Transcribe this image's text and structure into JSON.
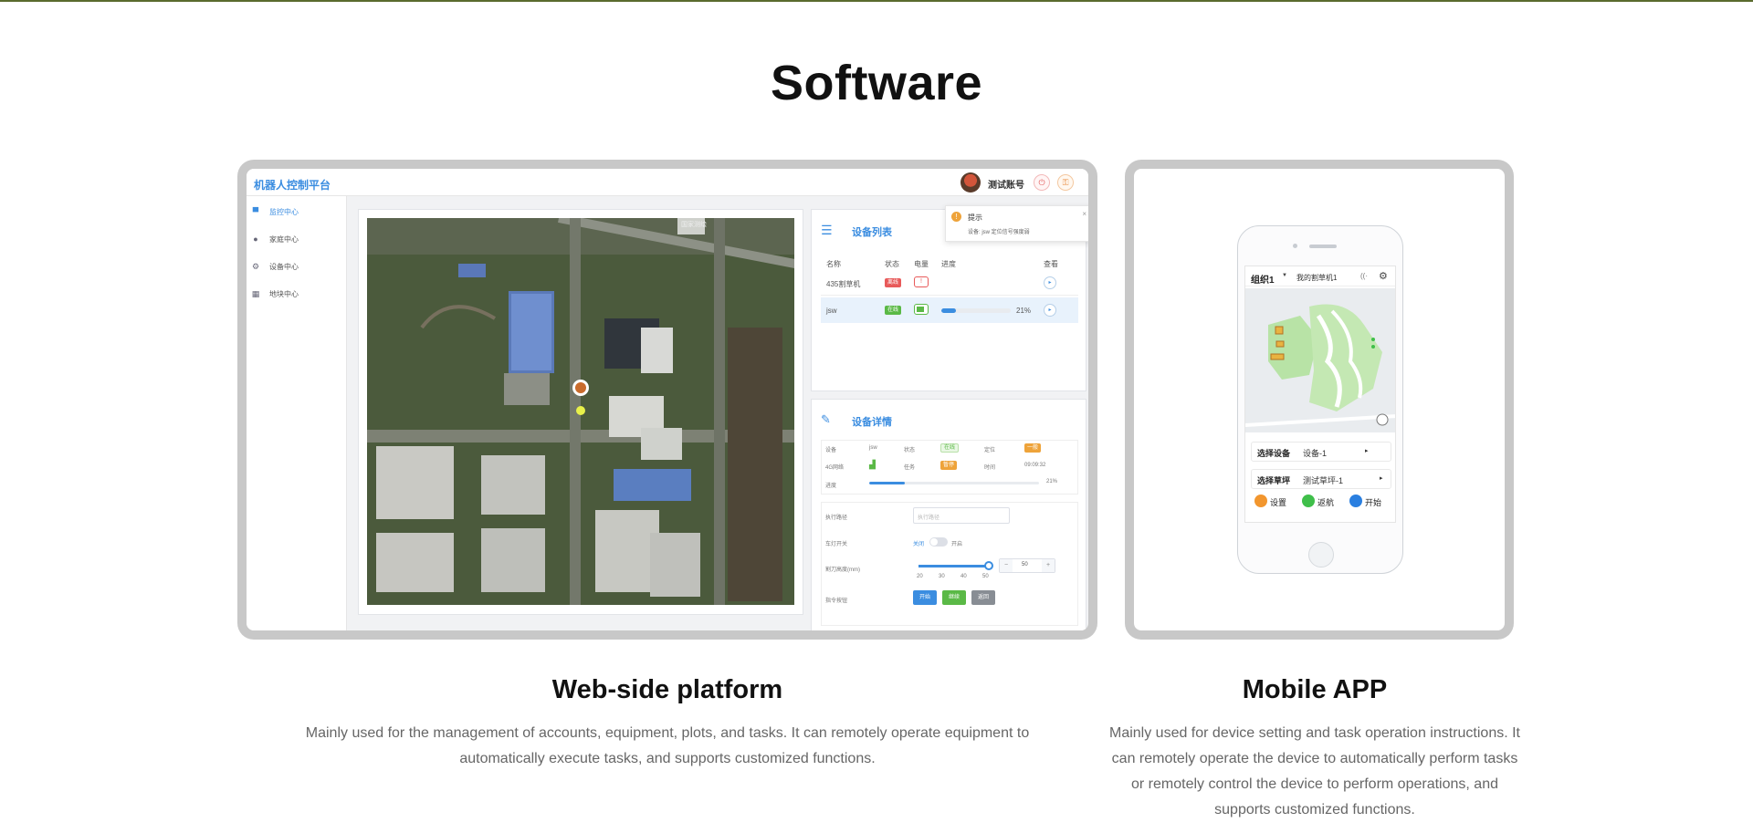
{
  "page": {
    "title": "Software"
  },
  "web_platform": {
    "brand": "机器人控制平台",
    "user_name": "测试账号",
    "nav": [
      {
        "label": "监控中心",
        "icon": "monitor-icon",
        "active": true
      },
      {
        "label": "家庭中心",
        "icon": "user-icon",
        "active": false
      },
      {
        "label": "设备中心",
        "icon": "gear-icon",
        "active": false
      },
      {
        "label": "地块中心",
        "icon": "grid-icon",
        "active": false
      }
    ],
    "map": {
      "watermark": "国家测绘"
    },
    "toast": {
      "title": "提示",
      "message": "设备: jsw 定位信号强度弱"
    },
    "device_list": {
      "title": "设备列表",
      "columns": [
        "名称",
        "状态",
        "电量",
        "进度",
        "查看"
      ],
      "rows": [
        {
          "name": "435割草机",
          "status": "离线",
          "progress": ""
        },
        {
          "name": "jsw",
          "status": "在线",
          "progress": "21%",
          "progress_value": 0.21
        }
      ]
    },
    "device_detail": {
      "title": "设备详情",
      "cells": {
        "device_label": "设备",
        "device_value": "jsw",
        "state_label": "状态",
        "state_value": "在线",
        "position_label": "定位",
        "position_value": "一般",
        "network_label": "4G网络",
        "task_label": "任务",
        "task_value": "暂停",
        "time_label": "时间",
        "time_value": "09:09:32",
        "progress_label": "进度",
        "progress_value": "21%",
        "progress_fraction": 0.21
      },
      "controls": {
        "route_label": "执行路径",
        "route_placeholder": "执行路径",
        "light_label": "车灯开关",
        "light_off": "关闭",
        "light_on": "开启",
        "height_label": "割刀高度(mm)",
        "height_ticks": [
          "20",
          "30",
          "40",
          "50"
        ],
        "height_value": "50",
        "stepper_minus": "−",
        "stepper_plus": "+",
        "command_label": "指令按钮",
        "btn_start": "开始",
        "btn_pause": "继续",
        "btn_stop": "返回"
      }
    }
  },
  "mobile_app": {
    "org": "组织1",
    "device_name": "我的割草机1",
    "select_device_label": "选择设备",
    "select_device_value": "设备-1",
    "select_lawn_label": "选择草坪",
    "select_lawn_value": "测试草坪-1",
    "actions": [
      {
        "label": "设置",
        "color": "#f2962e"
      },
      {
        "label": "返航",
        "color": "#3fbf4a"
      },
      {
        "label": "开始",
        "color": "#2a7fe0"
      }
    ]
  },
  "captions": {
    "web_title": "Web-side platform",
    "web_desc": "Mainly used for the management of accounts, equipment, plots, and tasks. It can remotely operate equipment to automatically execute tasks, and supports customized functions.",
    "mobile_title": "Mobile APP",
    "mobile_desc": "Mainly used for device setting and task operation instructions. It can remotely operate the device to automatically perform tasks or remotely control the device to perform operations, and supports customized functions."
  }
}
